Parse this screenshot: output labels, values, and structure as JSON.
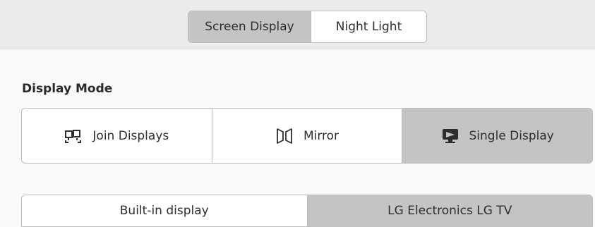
{
  "header": {
    "tabs": [
      {
        "label": "Screen Display",
        "active": true
      },
      {
        "label": "Night Light",
        "active": false
      }
    ]
  },
  "display_mode": {
    "title": "Display Mode",
    "options": [
      {
        "label": "Join Displays",
        "icon": "join-displays-icon",
        "active": false
      },
      {
        "label": "Mirror",
        "icon": "mirror-icon",
        "active": false
      },
      {
        "label": "Single Display",
        "icon": "single-display-icon",
        "active": true
      }
    ]
  },
  "displays": {
    "options": [
      {
        "label": "Built-in display",
        "active": false
      },
      {
        "label": "LG Electronics LG TV",
        "active": true
      }
    ]
  },
  "colors": {
    "active_bg": "#c4c4c4",
    "header_bg": "#ebebeb",
    "page_bg": "#fafafa"
  }
}
